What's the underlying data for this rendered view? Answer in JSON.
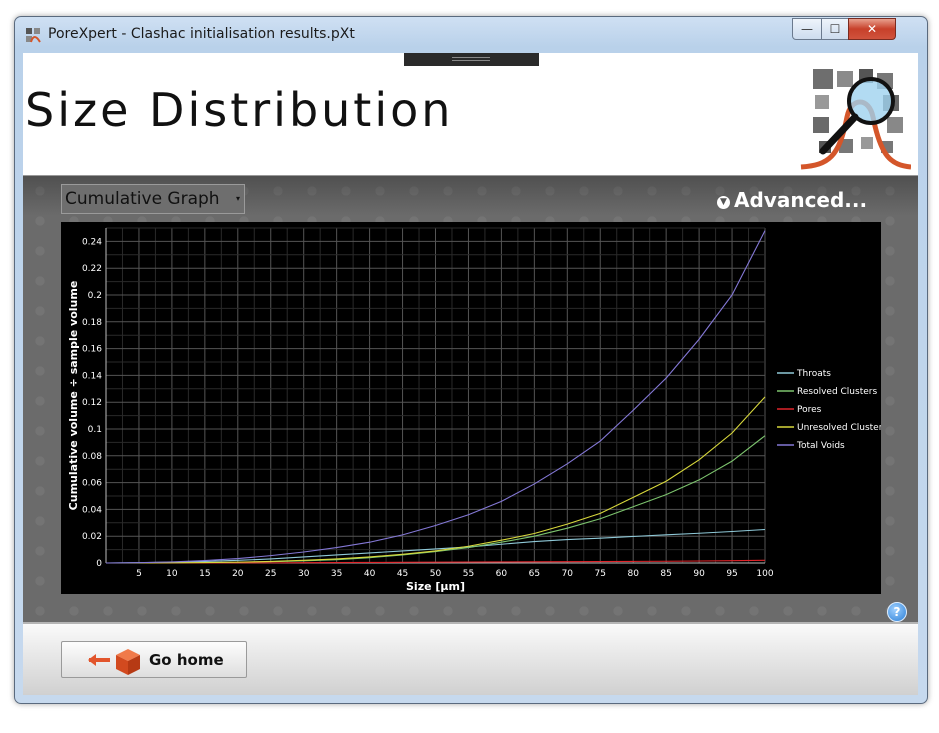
{
  "window": {
    "title": "PoreXpert - Clashac initialisation results.pXt",
    "controls": {
      "minimize": "—",
      "maximize": "☐",
      "close": "✕"
    }
  },
  "header": {
    "title": "Size Distribution"
  },
  "toolbar": {
    "graph_select": {
      "value": "Cumulative Graph",
      "arrow": "▾"
    },
    "advanced_label": "Advanced...",
    "advanced_icon": "chevron-down-icon"
  },
  "help": {
    "label": "?"
  },
  "footer": {
    "go_home_label": "Go home"
  },
  "colors": {
    "throats": "#8fc9d8",
    "resolved_clusters": "#7dc46e",
    "pores": "#e0242a",
    "unresolved_clusters": "#d8d83c",
    "total_voids": "#8478d6"
  },
  "chart_data": {
    "type": "line",
    "xlabel": "Size [µm]",
    "ylabel": "Cumulative volume ÷ sample volume",
    "xlim": [
      0,
      100
    ],
    "ylim": [
      0,
      0.25
    ],
    "x_ticks": [
      5,
      10,
      15,
      20,
      25,
      30,
      35,
      40,
      45,
      50,
      55,
      60,
      65,
      70,
      75,
      80,
      85,
      90,
      95,
      100
    ],
    "y_ticks": [
      0,
      0.02,
      0.04,
      0.06,
      0.08,
      0.1,
      0.12,
      0.14,
      0.16,
      0.18,
      0.2,
      0.22,
      0.24
    ],
    "grid": true,
    "legend_position": "right",
    "x": [
      0,
      5,
      10,
      15,
      20,
      25,
      30,
      35,
      40,
      45,
      50,
      55,
      60,
      65,
      70,
      75,
      80,
      85,
      90,
      95,
      100
    ],
    "series": [
      {
        "name": "Throats",
        "color": "#8fc9d8",
        "values": [
          0,
          0.0002,
          0.0006,
          0.0012,
          0.002,
          0.003,
          0.0045,
          0.006,
          0.0075,
          0.009,
          0.0105,
          0.012,
          0.014,
          0.016,
          0.0175,
          0.0185,
          0.0198,
          0.021,
          0.0222,
          0.0235,
          0.025
        ]
      },
      {
        "name": "Resolved Clusters",
        "color": "#7dc46e",
        "values": [
          0,
          0,
          0.0001,
          0.0002,
          0.0005,
          0.001,
          0.0016,
          0.0025,
          0.004,
          0.006,
          0.0085,
          0.0115,
          0.0155,
          0.02,
          0.026,
          0.033,
          0.042,
          0.051,
          0.062,
          0.076,
          0.095
        ]
      },
      {
        "name": "Pores",
        "color": "#e0242a",
        "values": [
          0,
          0,
          0,
          0,
          0.0001,
          0.0001,
          0.0002,
          0.0003,
          0.0004,
          0.0005,
          0.0006,
          0.0007,
          0.0008,
          0.0009,
          0.001,
          0.0011,
          0.0012,
          0.0013,
          0.0015,
          0.0017,
          0.002
        ]
      },
      {
        "name": "Unresolved Clusters",
        "color": "#d8d83c",
        "values": [
          0,
          0,
          0.0001,
          0.0003,
          0.0006,
          0.0012,
          0.002,
          0.003,
          0.0045,
          0.0065,
          0.009,
          0.0125,
          0.017,
          0.022,
          0.029,
          0.037,
          0.049,
          0.061,
          0.077,
          0.097,
          0.124
        ]
      },
      {
        "name": "Total Voids",
        "color": "#8478d6",
        "values": [
          0,
          0.0002,
          0.0008,
          0.0018,
          0.0033,
          0.0055,
          0.0082,
          0.0115,
          0.0155,
          0.021,
          0.028,
          0.036,
          0.046,
          0.059,
          0.074,
          0.091,
          0.114,
          0.138,
          0.167,
          0.2,
          0.248
        ]
      }
    ]
  }
}
